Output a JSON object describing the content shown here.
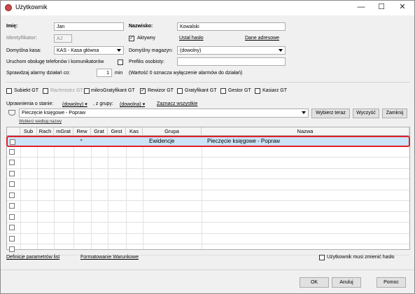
{
  "window": {
    "title": "Użytkownik",
    "minimize": "—",
    "maximize": "☐",
    "close": "✕"
  },
  "form": {
    "imie_label": "Imię:",
    "imie_value": "Jan",
    "nazwisko_label": "Nazwisko:",
    "nazwisko_value": "Kowalski",
    "identyfikator_label": "Identyfikator:",
    "identyfikator_value": "AJ",
    "aktywny_label": "Aktywny",
    "aktywny_checked": "✓",
    "ustal_haslo": "Ustal hasło",
    "dane_adresowe": "Dane adresowe",
    "kasa_label": "Domyślna kasa:",
    "kasa_value": "KAS - Kasa główna",
    "magazyn_label": "Domyślny magazyn:",
    "magazyn_value": "(dowolny)",
    "uruchom_label": "Uruchom obsługę telefonów i komunikatorów",
    "prefiks_label": "Prefiks osobisty:",
    "prefiks_value": "",
    "alarmy_label": "Sprawdzaj alarmy działań co:",
    "alarmy_value": "1",
    "alarmy_unit": "min",
    "alarmy_note": "(Wartość 0 oznacza wyłączenie alarmów do działań)"
  },
  "roles": [
    {
      "label": "Subiekt GT",
      "checked": "",
      "grey": false
    },
    {
      "label": "Rachmistrz GT",
      "checked": "",
      "grey": true
    },
    {
      "label": "mikroGratyfikant GT",
      "checked": "",
      "grey": false
    },
    {
      "label": "Rewizor GT",
      "checked": "✓",
      "grey": false
    },
    {
      "label": "Gratyfikant GT",
      "checked": "",
      "grey": false
    },
    {
      "label": "Gestor GT",
      "checked": "",
      "grey": false
    },
    {
      "label": "Kasiarz GT",
      "checked": "",
      "grey": false
    }
  ],
  "filters": {
    "uprawnienia_label": "Uprawnienia o stanie:",
    "stan_value": "(dowolny)",
    "grupy_label": ", z grupy:",
    "grupa_value": "(dowolna)",
    "zaznacz_wszystkie": "Zaznacz wszystkie"
  },
  "search": {
    "value": "Pieczęcie księgowe - Popraw",
    "hint": "Wybierz według nazwy",
    "wybierz_teraz": "Wybierz teraz",
    "wyczysc": "Wyczyść",
    "zamknij": "Zamknij"
  },
  "grid": {
    "columns": [
      "Sub",
      "Rach",
      "mGrat",
      "Rew",
      "Grat",
      "Gest",
      "Kas",
      "Grupa",
      "Nazwa"
    ],
    "rows": [
      {
        "grupa": "Ewidencje",
        "nazwa": "Pieczęcie księgowe - Popraw",
        "rew": "●"
      }
    ],
    "empty_rows": 10
  },
  "footer": {
    "definicje": "Definicje parametrów list",
    "formatowanie": "Formatowanie Warunkowe",
    "musi_zmienic": "Użytkownik musi zmienić hasło",
    "ok": "OK",
    "anuluj": "Anuluj",
    "pomoc": "Pomoc"
  },
  "colors": {
    "highlight": "#cce4f7",
    "highlight_border": "#e0202a"
  }
}
